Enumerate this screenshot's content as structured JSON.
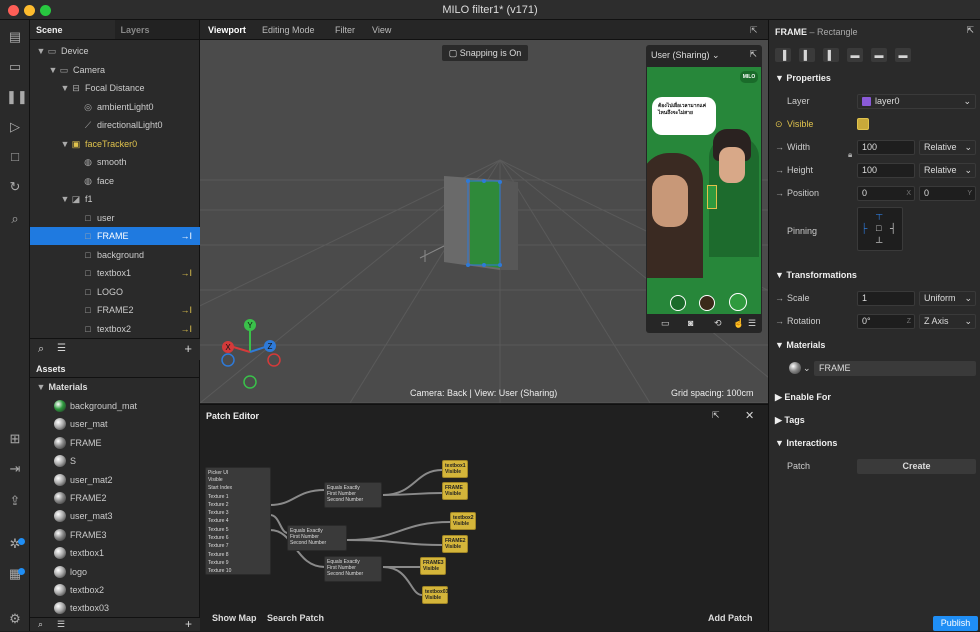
{
  "window": {
    "title": "MILO filter1* (v171)"
  },
  "scene_tabs": [
    "Scene",
    "Layers"
  ],
  "scene_tree": [
    {
      "label": "Device",
      "indent": 0,
      "arrow": "▼",
      "icon": "device-icon",
      "glyph": "▭"
    },
    {
      "label": "Camera",
      "indent": 1,
      "arrow": "▼",
      "icon": "camera-icon",
      "glyph": "▭"
    },
    {
      "label": "Focal Distance",
      "indent": 2,
      "arrow": "▼",
      "icon": "focal-distance-icon",
      "glyph": "⊟"
    },
    {
      "label": "ambientLight0",
      "indent": 3,
      "arrow": "",
      "icon": "ambient-light-icon",
      "glyph": "◎"
    },
    {
      "label": "directionalLight0",
      "indent": 3,
      "arrow": "",
      "icon": "directional-light-icon",
      "glyph": "⟋"
    },
    {
      "label": "faceTracker0",
      "indent": 2,
      "arrow": "▼",
      "icon": "face-tracker-icon",
      "glyph": "▣",
      "yellow": true
    },
    {
      "label": "smooth",
      "indent": 3,
      "arrow": "",
      "icon": "mesh-icon",
      "glyph": "◍"
    },
    {
      "label": "face",
      "indent": 3,
      "arrow": "",
      "icon": "mesh-icon",
      "glyph": "◍"
    },
    {
      "label": "f1",
      "indent": 2,
      "arrow": "▼",
      "icon": "canvas-icon",
      "glyph": "◪"
    },
    {
      "label": "user",
      "indent": 3,
      "arrow": "",
      "icon": "rectangle-icon",
      "glyph": "□"
    },
    {
      "label": "FRAME",
      "indent": 3,
      "arrow": "",
      "icon": "rectangle-icon",
      "glyph": "□",
      "selected": true,
      "link": "→I"
    },
    {
      "label": "background",
      "indent": 3,
      "arrow": "",
      "icon": "rectangle-icon",
      "glyph": "□"
    },
    {
      "label": "textbox1",
      "indent": 3,
      "arrow": "",
      "icon": "rectangle-icon",
      "glyph": "□",
      "link": "→I"
    },
    {
      "label": "LOGO",
      "indent": 3,
      "arrow": "",
      "icon": "rectangle-icon",
      "glyph": "□"
    },
    {
      "label": "FRAME2",
      "indent": 3,
      "arrow": "",
      "icon": "rectangle-icon",
      "glyph": "□",
      "link": "→I"
    },
    {
      "label": "textbox2",
      "indent": 3,
      "arrow": "",
      "icon": "rectangle-icon",
      "glyph": "□",
      "link": "→I"
    }
  ],
  "assets": {
    "title": "Assets",
    "group": "Materials",
    "items": [
      "background_mat",
      "user_mat",
      "FRAME",
      "S",
      "user_mat2",
      "FRAME2",
      "user_mat3",
      "FRAME3",
      "textbox1",
      "logo",
      "textbox2",
      "textbox03"
    ],
    "colors": [
      "#2d9a3d",
      "#aaa",
      "#888",
      "#aaa",
      "#aaa",
      "#888",
      "#aaa",
      "#888",
      "#aaa",
      "#aaa",
      "#aaa",
      "#aaa"
    ]
  },
  "viewport": {
    "tabs": [
      "Viewport",
      "Editing Mode",
      "Filter",
      "View"
    ],
    "snapping": "Snapping is On",
    "preview_device": "User (Sharing)",
    "camera_info": "Camera: Back | View: User (Sharing)",
    "grid_spacing": "Grid spacing: 100cm",
    "preview_caption": "ต้องไปเผื่อเวลามากแค่ไหนถึงจะไม่สาย",
    "brand": "MILO",
    "axis_labels": [
      "Y",
      "X",
      "Z"
    ]
  },
  "patch_editor": {
    "title": "Patch Editor",
    "show_map": "Show Map",
    "search_patch": "Search Patch",
    "add_patch": "Add Patch",
    "picker": {
      "title": "Picker UI",
      "rows": [
        "Visible",
        "Start Index",
        "Texture 1",
        "Texture 2",
        "Texture 3",
        "Texture 4",
        "Texture 5",
        "Texture 6",
        "Texture 7",
        "Texture 8",
        "Texture 9",
        "Texture 10"
      ]
    },
    "equals": [
      {
        "title": "Equals Exactly",
        "a": "First Number",
        "b": "Second Number"
      },
      {
        "title": "Equals Exactly",
        "a": "First Number",
        "b": "Second Number"
      },
      {
        "title": "Equals Exactly",
        "a": "First Number",
        "b": "Second Number"
      }
    ],
    "outputs": [
      "textbox1",
      "FRAME",
      "textbox2",
      "FRAME2",
      "FRAME3",
      "textbox03"
    ],
    "visible_label": "Visible"
  },
  "properties": {
    "object_name": "FRAME",
    "object_type": "– Rectangle",
    "sections": {
      "properties": "Properties",
      "transformations": "Transformations",
      "materials": "Materials",
      "enable_for": "Enable For",
      "tags": "Tags",
      "interactions": "Interactions"
    },
    "layer_label": "Layer",
    "layer_value": "layer0",
    "visible_label": "Visible",
    "width_label": "Width",
    "width_value": "100",
    "width_unit": "Relative",
    "height_label": "Height",
    "height_value": "100",
    "height_unit": "Relative",
    "position_label": "Position",
    "pos_x": "0",
    "pos_y": "0",
    "pos_x_unit": "X",
    "pos_y_unit": "Y",
    "pinning_label": "Pinning",
    "scale_label": "Scale",
    "scale_value": "1",
    "scale_mode": "Uniform",
    "rotation_label": "Rotation",
    "rotation_value": "0°",
    "rotation_unit": "Z",
    "rotation_axis": "Z Axis",
    "material_value": "FRAME",
    "patch_label": "Patch",
    "create_label": "Create"
  },
  "publish_label": "Publish"
}
